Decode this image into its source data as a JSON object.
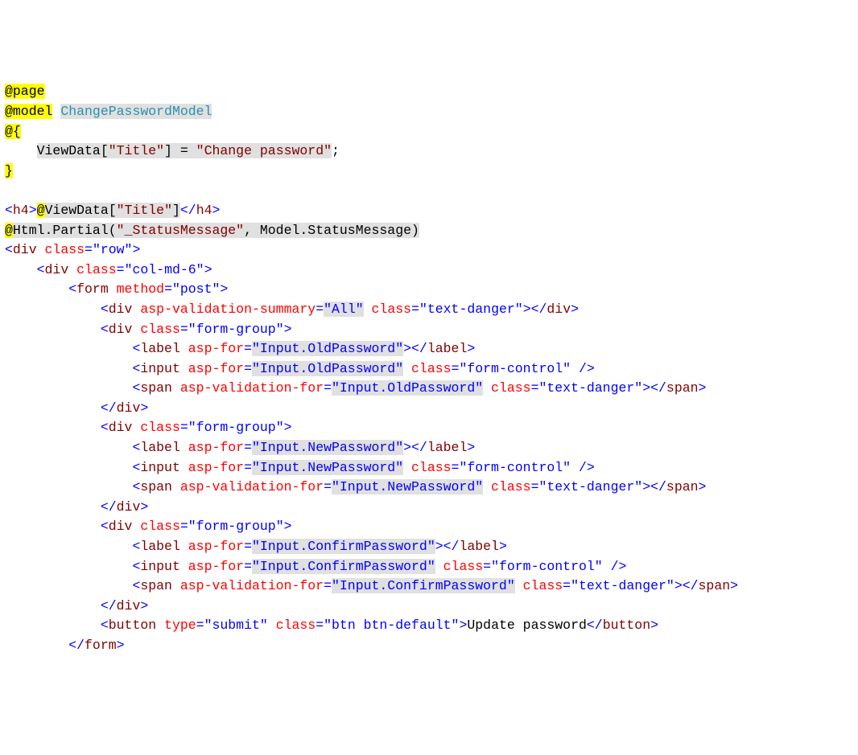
{
  "code": {
    "l1_page": "@page",
    "l2_model": "@model",
    "l2_type": "ChangePasswordModel",
    "l3_open": "@{",
    "l4_viewdata": "ViewData",
    "l4_key": "\"Title\"",
    "l4_eq": " = ",
    "l4_val": "\"Change password\"",
    "l4_semi": ";",
    "l5_close": "}",
    "l7_open": "<",
    "l7_tag": "h4",
    "l7_close": ">",
    "l7_at": "@",
    "l7_vd": "ViewData[",
    "l7_key": "\"Title\"",
    "l7_vd_end": "]",
    "l7_ctag": "</",
    "l8_at": "@",
    "l8_call": "Html.Partial(",
    "l8_arg1": "\"_StatusMessage\"",
    "l8_arg2": ", Model.StatusMessage)",
    "div": "div",
    "form": "form",
    "label": "label",
    "input": "input",
    "span": "span",
    "button": "button",
    "class_attr": "class",
    "method_attr": "method",
    "aspfor_attr": "asp-for",
    "aspvs_attr": "asp-validation-summary",
    "aspvf_attr": "asp-validation-for",
    "type_attr": "type",
    "val_row": "\"row\"",
    "val_col": "\"col-md-6\"",
    "val_post": "\"post\"",
    "val_all": "\"All\"",
    "val_textdanger": "\"text-danger\"",
    "val_formgroup": "\"form-group\"",
    "val_formcontrol": "\"form-control\"",
    "val_oldpw": "\"Input.OldPassword\"",
    "val_newpw": "\"Input.NewPassword\"",
    "val_confirmpw": "\"Input.ConfirmPassword\"",
    "val_submit": "\"submit\"",
    "val_btn": "\"btn btn-default\"",
    "btn_text": "Update password"
  }
}
